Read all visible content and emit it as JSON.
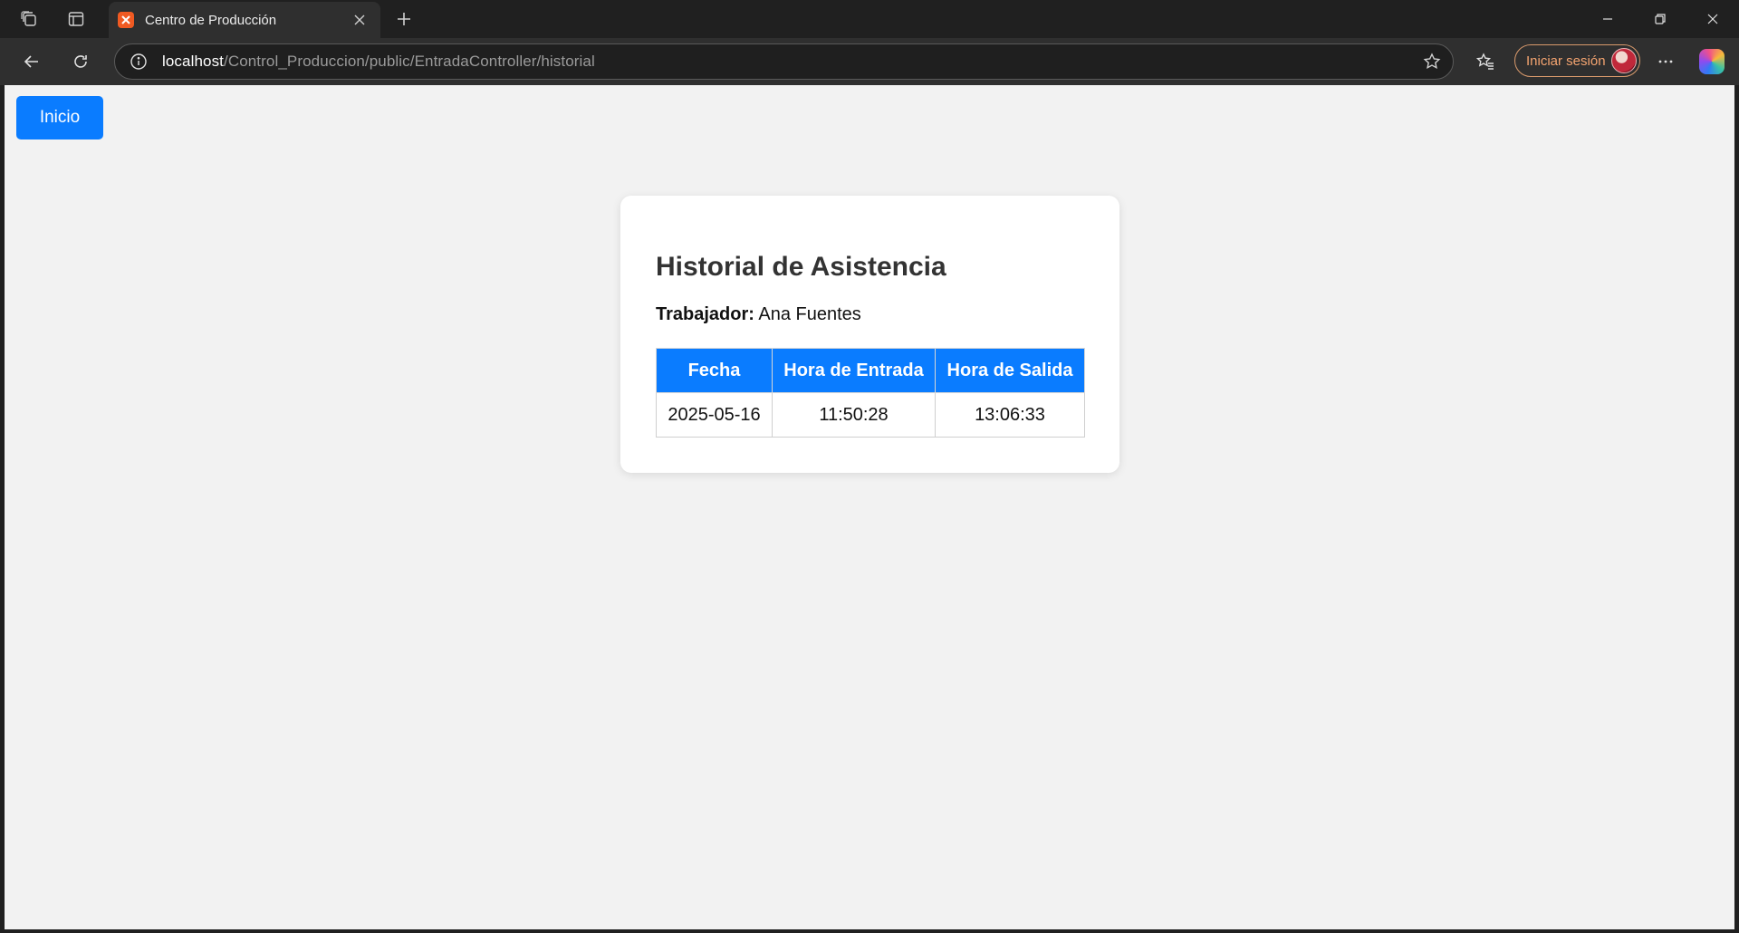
{
  "browser": {
    "tab": {
      "title": "Centro de Producción"
    },
    "address_bar": {
      "host": "localhost",
      "path": "/Control_Produccion/public/EntradaController/historial"
    },
    "profile": {
      "signin_label": "Iniciar sesión"
    }
  },
  "page": {
    "home_button": "Inicio",
    "card": {
      "title": "Historial de Asistencia",
      "worker_label": "Trabajador:",
      "worker_name": "Ana Fuentes",
      "table": {
        "headers": [
          "Fecha",
          "Hora de Entrada",
          "Hora de Salida"
        ],
        "rows": [
          [
            "2025-05-16",
            "11:50:28",
            "13:06:33"
          ]
        ]
      }
    }
  },
  "colors": {
    "accent_blue": "#0a7cff",
    "page_background": "#f2f2f2",
    "browser_chrome": "#202020",
    "signin_orange": "#f4a470"
  }
}
